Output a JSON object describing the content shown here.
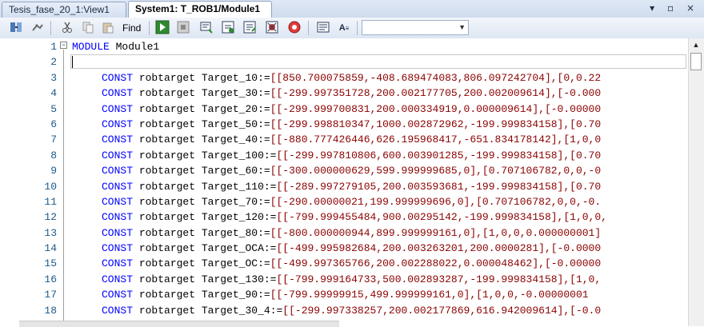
{
  "tabs": [
    {
      "label": "Tesis_fase_20_1:View1"
    },
    {
      "label": "System1: T_ROB1/Module1"
    }
  ],
  "window_controls": "▾ ▫ ×",
  "toolbar": {
    "find_label": "Find",
    "combo_value": "",
    "icons": [
      "load-module-icon",
      "robot-icon",
      "cut-icon",
      "copy-icon",
      "paste-icon",
      "play-icon",
      "stop-icon",
      "step-icon",
      "step-over-icon",
      "step-out-icon",
      "breakpoint-icon",
      "record-icon",
      "list-icon",
      "font-icon"
    ]
  },
  "editor": {
    "lines": [
      {
        "num": "1",
        "text": "MODULE Module1",
        "kind": "module"
      },
      {
        "num": "2",
        "text": "",
        "kind": "blank"
      },
      {
        "num": "3",
        "name": "Target_10",
        "value": "[[850.700075859,-408.689474083,806.097242704],[0,0.22"
      },
      {
        "num": "4",
        "name": "Target_30",
        "value": "[[-299.997351728,200.002177705,200.002009614],[-0.000"
      },
      {
        "num": "5",
        "name": "Target_20",
        "value": "[[-299.999700831,200.000334919,0.000009614],[-0.00000"
      },
      {
        "num": "6",
        "name": "Target_50",
        "value": "[[-299.998810347,1000.002872962,-199.999834158],[0.70"
      },
      {
        "num": "7",
        "name": "Target_40",
        "value": "[[-880.777426446,626.195968417,-651.834178142],[1,0,0"
      },
      {
        "num": "8",
        "name": "Target_100",
        "value": "[[-299.997810806,600.003901285,-199.999834158],[0.70"
      },
      {
        "num": "9",
        "name": "Target_60",
        "value": "[[-300.000000629,599.999999685,0],[0.707106782,0,0,-0"
      },
      {
        "num": "10",
        "name": "Target_110",
        "value": "[[-289.997279105,200.003593681,-199.999834158],[0.70"
      },
      {
        "num": "11",
        "name": "Target_70",
        "value": "[[-290.00000021,199.999999696,0],[0.707106782,0,0,-0."
      },
      {
        "num": "12",
        "name": "Target_120",
        "value": "[[-799.999455484,900.00295142,-199.999834158],[1,0,0,"
      },
      {
        "num": "13",
        "name": "Target_80",
        "value": "[[-800.000000944,899.999999161,0],[1,0,0,0.000000001]"
      },
      {
        "num": "14",
        "name": "Target_OCA",
        "value": "[[-499.995982684,200.003263201,200.0000281],[-0.0000"
      },
      {
        "num": "15",
        "name": "Target_OC",
        "value": "[[-499.997365766,200.002288022,0.000048462],[-0.00000"
      },
      {
        "num": "16",
        "name": "Target_130",
        "value": "[[-799.999164733,500.002893287,-199.999834158],[1,0,"
      },
      {
        "num": "17",
        "name": "Target_90",
        "value": "[[-799.99999915,499.999999161,0],[1,0,0,-0.00000001"
      },
      {
        "num": "18",
        "name": "Target_30_4",
        "value": "[[-299.997338257,200.002177869,616.942009614],[-0.0"
      }
    ],
    "keyword_const": "CONST",
    "keyword_type": "robtarget",
    "assign_op": ":="
  }
}
